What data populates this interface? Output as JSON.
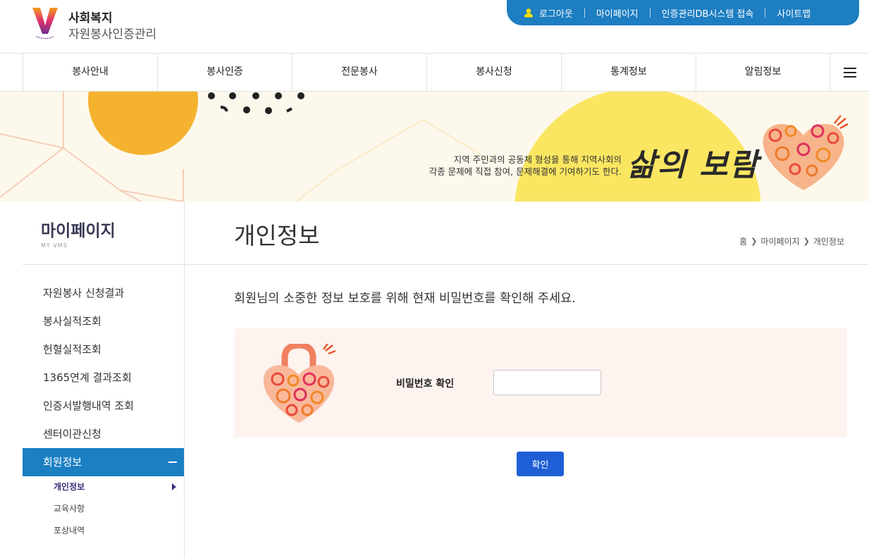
{
  "header": {
    "logo_line1": "사회복지",
    "logo_line2": "자원봉사인증관리",
    "util": {
      "logout": "로그아웃",
      "mypage": "마이페이지",
      "db_access": "인증관리DB시스템 접속",
      "sitemap": "사이트맵"
    }
  },
  "gnb": {
    "items": [
      "봉사안내",
      "봉사인증",
      "전문봉사",
      "봉사신청",
      "통계정보",
      "알림정보"
    ]
  },
  "banner": {
    "desc_line1": "지역 주민과의 공동체 형성을 통해 지역사회의",
    "desc_line2": "각종 문제에 직접 참여, 문제해결에 기여하기도 한다.",
    "slogan": "삶의 보람"
  },
  "lnb": {
    "title": "마이페이지",
    "subtitle": "MY VMS",
    "items": [
      "자원봉사 신청결과",
      "봉사실적조회",
      "헌혈실적조회",
      "1365연계 결과조회",
      "인증서발행내역 조회",
      "센터이관신청"
    ],
    "active_item": "회원정보",
    "sub_items": [
      "개인정보",
      "교육사항",
      "포상내역"
    ]
  },
  "content": {
    "page_title": "개인정보",
    "breadcrumb": [
      "홈",
      "마이페이지",
      "개인정보"
    ],
    "notice": "회원님의 소중한 정보 보호를 위해 현재 비밀번호를 확인해 주세요.",
    "password_label": "비밀번호 확인",
    "password_value": "",
    "confirm_label": "확인"
  },
  "colors": {
    "util_bar": "#1d7ec1",
    "lnb_active": "#1b7fc2",
    "confirm_button": "#1f5fd6",
    "pw_box_bg": "#fdf3ef",
    "banner_bg": "#fdf8ec"
  },
  "icons": {
    "user": "user-icon",
    "menu": "hamburger-menu-icon",
    "lock": "heart-lock-icon",
    "heart": "heart-illustration"
  }
}
